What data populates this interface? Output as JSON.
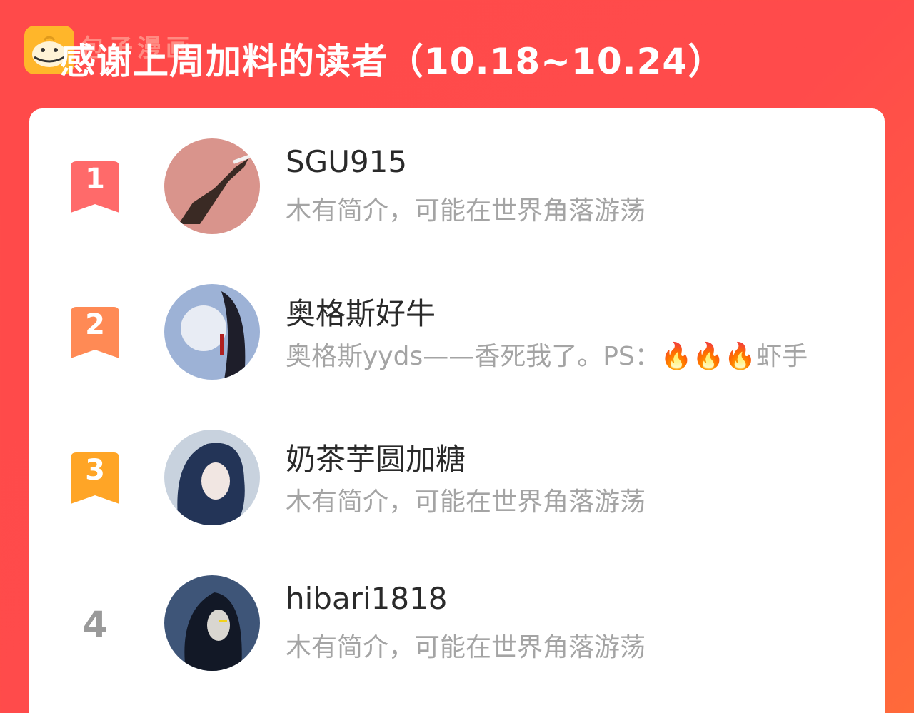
{
  "header": {
    "watermark": "包子漫画",
    "title": "感谢上周加料的读者（10.18~10.24）",
    "logo_icon": "bun-logo-icon"
  },
  "colors": {
    "background": "#ff4b4b",
    "rank1": "#ff6a6a",
    "rank2": "#ff8a55",
    "rank3": "#ffa526",
    "rank_plain": "#9a9a9a"
  },
  "readers": [
    {
      "rank": "1",
      "name": "SGU915",
      "desc": "木有简介，可能在世界角落游荡"
    },
    {
      "rank": "2",
      "name": "奥格斯好牛",
      "desc": "奥格斯yyds——香死我了。PS：🔥🔥🔥虾手"
    },
    {
      "rank": "3",
      "name": "奶茶芋圆加糖",
      "desc": "木有简介，可能在世界角落游荡"
    },
    {
      "rank": "4",
      "name": "hibari1818",
      "desc": "木有简介，可能在世界角落游荡"
    }
  ]
}
